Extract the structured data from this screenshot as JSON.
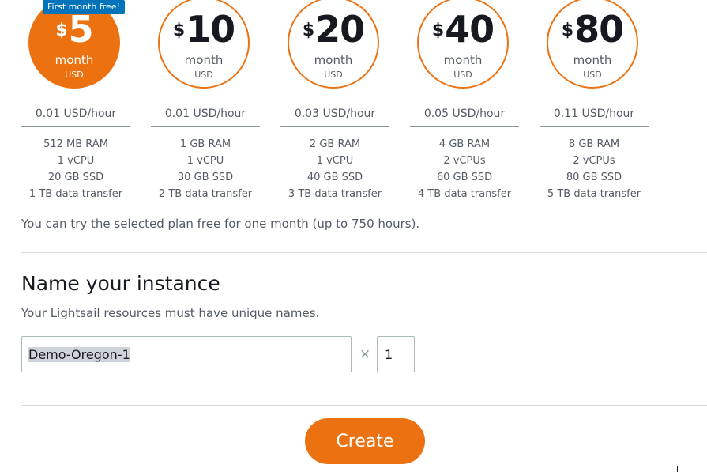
{
  "plans": [
    {
      "currency": "$",
      "amount": "5",
      "period": "month",
      "unit": "USD",
      "hourly": "0.01 USD/hour",
      "ram": "512 MB RAM",
      "cpu": "1 vCPU",
      "ssd": "20 GB SSD",
      "transfer": "1 TB data transfer",
      "selected": true,
      "badge": "First month free!"
    },
    {
      "currency": "$",
      "amount": "10",
      "period": "month",
      "unit": "USD",
      "hourly": "0.01 USD/hour",
      "ram": "1 GB RAM",
      "cpu": "1 vCPU",
      "ssd": "30 GB SSD",
      "transfer": "2 TB data transfer",
      "selected": false
    },
    {
      "currency": "$",
      "amount": "20",
      "period": "month",
      "unit": "USD",
      "hourly": "0.03 USD/hour",
      "ram": "2 GB RAM",
      "cpu": "1 vCPU",
      "ssd": "40 GB SSD",
      "transfer": "3 TB data transfer",
      "selected": false
    },
    {
      "currency": "$",
      "amount": "40",
      "period": "month",
      "unit": "USD",
      "hourly": "0.05 USD/hour",
      "ram": "4 GB RAM",
      "cpu": "2 vCPUs",
      "ssd": "60 GB SSD",
      "transfer": "4 TB data transfer",
      "selected": false
    },
    {
      "currency": "$",
      "amount": "80",
      "period": "month",
      "unit": "USD",
      "hourly": "0.11 USD/hour",
      "ram": "8 GB RAM",
      "cpu": "2 vCPUs",
      "ssd": "80 GB SSD",
      "transfer": "5 TB data transfer",
      "selected": false
    }
  ],
  "free_trial_note": "You can try the selected plan free for one month (up to 750 hours).",
  "name_section": {
    "title": "Name your instance",
    "subtitle": "Your Lightsail resources must have unique names.",
    "name_value": "Demo-Oregon-1",
    "multiplier": "×",
    "count_value": "1"
  },
  "create_label": "Create",
  "colors": {
    "accent": "#ec7211",
    "badge": "#0073bb"
  }
}
